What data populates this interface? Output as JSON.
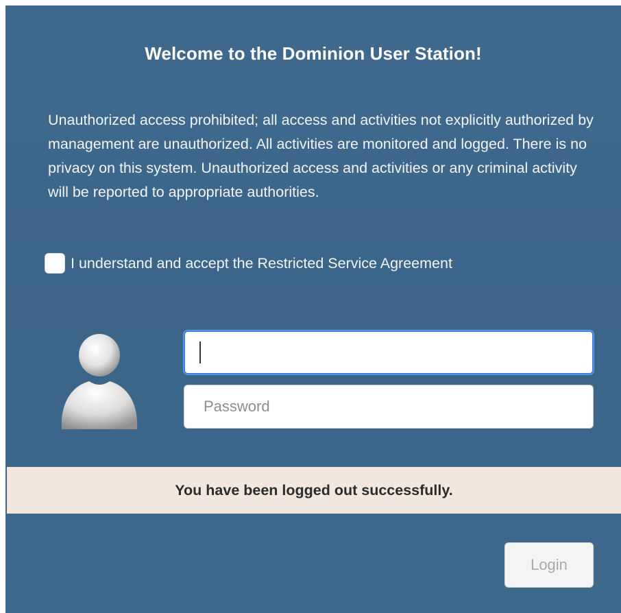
{
  "dialog": {
    "title": "Welcome to the Dominion User Station!",
    "notice": "Unauthorized access prohibited; all access and activities not explicitly authorized by management are unauthorized. All activities are monitored and logged. There is no privacy on this system. Unauthorized access and activities or any criminal activity will be reported to appropriate authorities.",
    "agreement": {
      "label": "I understand and accept the Restricted Service Agreement",
      "checked": false
    },
    "avatar_icon": "user-silhouette-icon",
    "username": {
      "value": "",
      "placeholder": ""
    },
    "password": {
      "value": "",
      "placeholder": "Password"
    },
    "status_message": "You have been logged out successfully.",
    "login_label": "Login",
    "colors": {
      "panel_background": "#3e6a8d",
      "status_background": "#f1e7df",
      "focus_border": "#3b82e0"
    }
  }
}
